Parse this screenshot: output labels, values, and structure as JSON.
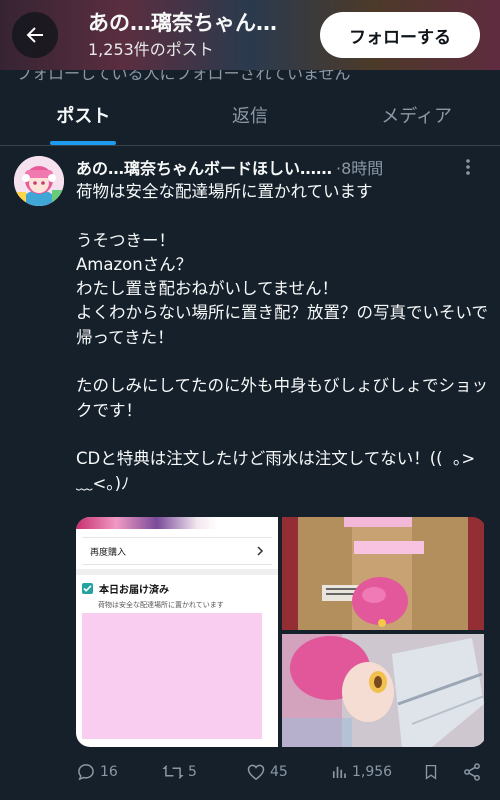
{
  "header": {
    "name": "あの…璃奈ちゃん…",
    "post_count": "1,253件のポスト",
    "follow_label": "フォローする",
    "banner_note": "フォローしている人にフォローされていません"
  },
  "tabs": [
    {
      "label": "ポスト",
      "active": true
    },
    {
      "label": "返信",
      "active": false
    },
    {
      "label": "メディア",
      "active": false
    }
  ],
  "post": {
    "author": "あの…璃奈ちゃんボードほしい……",
    "time": "·8時間",
    "text": "荷物は安全な配達場所に置かれています\n\nうそつきー！\nAmazonさん？\nわたし置き配おねがいしてません！\nよくわからない場所に置き配？放置？の写真でいそいで帰ってきた！\n\nたのしみにしてたのに外も中身もびしょびしょでショックです！\n\nCDと特典は注文したけど雨水は注文してない！((  ｡>﹏<｡)ﾉ",
    "media": {
      "rebuy_label": "再度購入",
      "delivered_title": "本日お届け済み",
      "delivered_sub": "荷物は安全な配達場所に置かれています"
    },
    "actions": {
      "replies": "16",
      "reposts": "5",
      "likes": "45",
      "views": "1,956"
    }
  },
  "colors": {
    "background": "#15202b",
    "accent": "#1d9bf0",
    "muted": "#8b98a5"
  }
}
